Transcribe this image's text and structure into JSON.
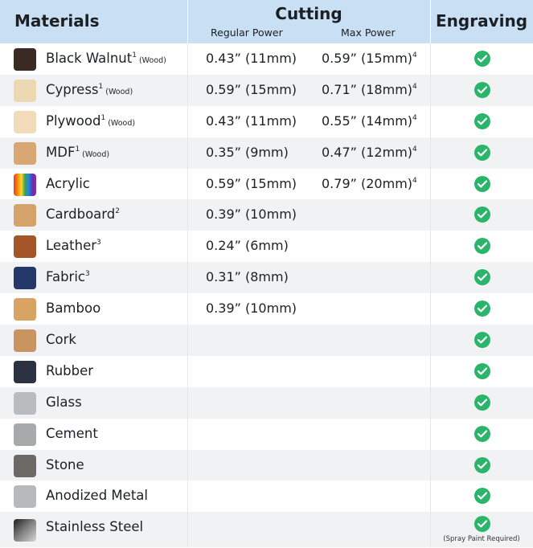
{
  "header": {
    "materials": "Materials",
    "cutting": "Cutting",
    "regular_power": "Regular Power",
    "max_power": "Max Power",
    "engraving": "Engraving"
  },
  "rows": [
    {
      "name": "Black Walnut",
      "sup": "1",
      "note": "(Wood)",
      "regular": "0.43” (11mm)",
      "max": "0.59” (15mm)",
      "max_sup": "4",
      "swatch": "#3b2a24"
    },
    {
      "name": "Cypress",
      "sup": "1",
      "note": "(Wood)",
      "regular": "0.59” (15mm)",
      "max": "0.71” (18mm)",
      "max_sup": "4",
      "swatch": "#ecd9b3"
    },
    {
      "name": "Plywood",
      "sup": "1",
      "note": "(Wood)",
      "regular": "0.43” (11mm)",
      "max": "0.55” (14mm)",
      "max_sup": "4",
      "swatch": "#f1dbb8"
    },
    {
      "name": "MDF",
      "sup": "1",
      "note": "(Wood)",
      "regular": "0.35” (9mm)",
      "max": "0.47” (12mm)",
      "max_sup": "4",
      "swatch": "#d8a773"
    },
    {
      "name": "Acrylic",
      "sup": "",
      "note": "",
      "regular": "0.59” (15mm)",
      "max": "0.79” (20mm)",
      "max_sup": "4",
      "swatch": "rainbow"
    },
    {
      "name": "Cardboard",
      "sup": "2",
      "note": "",
      "regular": "0.39” (10mm)",
      "max": "",
      "max_sup": "",
      "swatch": "#d5a26a"
    },
    {
      "name": "Leather",
      "sup": "3",
      "note": "",
      "regular": "0.24” (6mm)",
      "max": "",
      "max_sup": "",
      "swatch": "#a4552a"
    },
    {
      "name": "Fabric",
      "sup": "3",
      "note": "",
      "regular": "0.31” (8mm)",
      "max": "",
      "max_sup": "",
      "swatch": "#25386a"
    },
    {
      "name": "Bamboo",
      "sup": "",
      "note": "",
      "regular": "0.39” (10mm)",
      "max": "",
      "max_sup": "",
      "swatch": "#d9a463"
    },
    {
      "name": "Cork",
      "sup": "",
      "note": "",
      "regular": "",
      "max": "",
      "max_sup": "",
      "swatch": "#c99362"
    },
    {
      "name": "Rubber",
      "sup": "",
      "note": "",
      "regular": "",
      "max": "",
      "max_sup": "",
      "swatch": "#2d3242"
    },
    {
      "name": "Glass",
      "sup": "",
      "note": "",
      "regular": "",
      "max": "",
      "max_sup": "",
      "swatch": "#b9bcbf"
    },
    {
      "name": "Cement",
      "sup": "",
      "note": "",
      "regular": "",
      "max": "",
      "max_sup": "",
      "swatch": "#a7aaab"
    },
    {
      "name": "Stone",
      "sup": "",
      "note": "",
      "regular": "",
      "max": "",
      "max_sup": "",
      "swatch": "#6a6966"
    },
    {
      "name": "Anodized Metal",
      "sup": "",
      "note": "",
      "regular": "",
      "max": "",
      "max_sup": "",
      "swatch": "#b7b9bb"
    },
    {
      "name": "Stainless Steel",
      "sup": "",
      "note": "",
      "regular": "",
      "max": "",
      "max_sup": "",
      "swatch": "steel",
      "engrave_note": "(Spray Paint Required)"
    }
  ],
  "colors": {
    "header_bg": "#c9dff3",
    "row_alt_bg": "#f1f2f3",
    "check_green": "#2ab56a"
  },
  "icons": {
    "engraving_supported": "check-circle-icon"
  }
}
